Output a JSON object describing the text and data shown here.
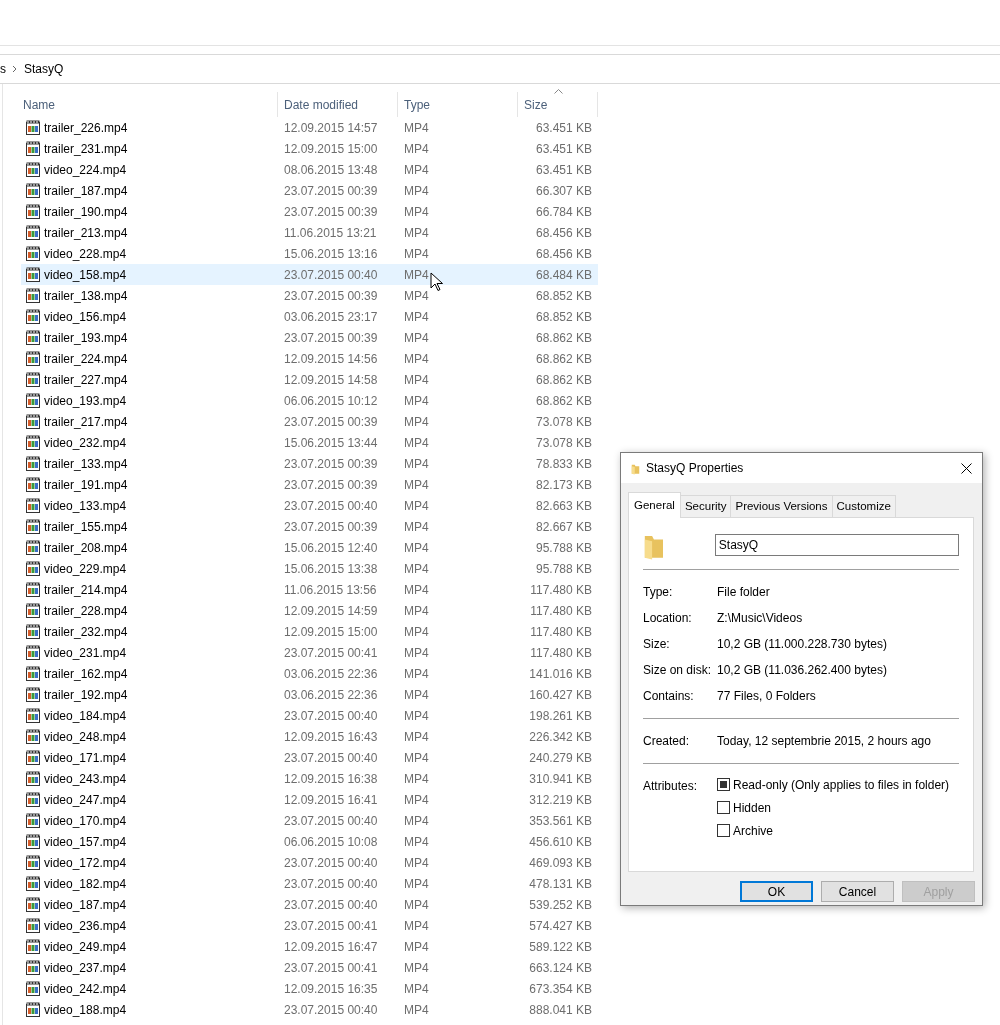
{
  "breadcrumb": {
    "cut_segment": "s",
    "current": "StasyQ"
  },
  "columns": [
    {
      "label": "Name",
      "sorted": false
    },
    {
      "label": "Date modified",
      "sorted": false
    },
    {
      "label": "Type",
      "sorted": false
    },
    {
      "label": "Size",
      "sorted": true
    }
  ],
  "files": [
    {
      "name": "trailer_226.mp4",
      "date": "12.09.2015 14:57",
      "type": "MP4",
      "size": "63.451 KB",
      "hovered": false
    },
    {
      "name": "trailer_231.mp4",
      "date": "12.09.2015 15:00",
      "type": "MP4",
      "size": "63.451 KB",
      "hovered": false
    },
    {
      "name": "video_224.mp4",
      "date": "08.06.2015 13:48",
      "type": "MP4",
      "size": "63.451 KB",
      "hovered": false
    },
    {
      "name": "trailer_187.mp4",
      "date": "23.07.2015 00:39",
      "type": "MP4",
      "size": "66.307 KB",
      "hovered": false
    },
    {
      "name": "trailer_190.mp4",
      "date": "23.07.2015 00:39",
      "type": "MP4",
      "size": "66.784 KB",
      "hovered": false
    },
    {
      "name": "trailer_213.mp4",
      "date": "11.06.2015 13:21",
      "type": "MP4",
      "size": "68.456 KB",
      "hovered": false
    },
    {
      "name": "video_228.mp4",
      "date": "15.06.2015 13:16",
      "type": "MP4",
      "size": "68.456 KB",
      "hovered": false
    },
    {
      "name": "video_158.mp4",
      "date": "23.07.2015 00:40",
      "type": "MP4",
      "size": "68.484 KB",
      "hovered": true
    },
    {
      "name": "trailer_138.mp4",
      "date": "23.07.2015 00:39",
      "type": "MP4",
      "size": "68.852 KB",
      "hovered": false
    },
    {
      "name": "video_156.mp4",
      "date": "03.06.2015 23:17",
      "type": "MP4",
      "size": "68.852 KB",
      "hovered": false
    },
    {
      "name": "trailer_193.mp4",
      "date": "23.07.2015 00:39",
      "type": "MP4",
      "size": "68.862 KB",
      "hovered": false
    },
    {
      "name": "trailer_224.mp4",
      "date": "12.09.2015 14:56",
      "type": "MP4",
      "size": "68.862 KB",
      "hovered": false
    },
    {
      "name": "trailer_227.mp4",
      "date": "12.09.2015 14:58",
      "type": "MP4",
      "size": "68.862 KB",
      "hovered": false
    },
    {
      "name": "video_193.mp4",
      "date": "06.06.2015 10:12",
      "type": "MP4",
      "size": "68.862 KB",
      "hovered": false
    },
    {
      "name": "trailer_217.mp4",
      "date": "23.07.2015 00:39",
      "type": "MP4",
      "size": "73.078 KB",
      "hovered": false
    },
    {
      "name": "video_232.mp4",
      "date": "15.06.2015 13:44",
      "type": "MP4",
      "size": "73.078 KB",
      "hovered": false
    },
    {
      "name": "trailer_133.mp4",
      "date": "23.07.2015 00:39",
      "type": "MP4",
      "size": "78.833 KB",
      "hovered": false
    },
    {
      "name": "trailer_191.mp4",
      "date": "23.07.2015 00:39",
      "type": "MP4",
      "size": "82.173 KB",
      "hovered": false
    },
    {
      "name": "video_133.mp4",
      "date": "23.07.2015 00:40",
      "type": "MP4",
      "size": "82.663 KB",
      "hovered": false
    },
    {
      "name": "trailer_155.mp4",
      "date": "23.07.2015 00:39",
      "type": "MP4",
      "size": "82.667 KB",
      "hovered": false
    },
    {
      "name": "trailer_208.mp4",
      "date": "15.06.2015 12:40",
      "type": "MP4",
      "size": "95.788 KB",
      "hovered": false
    },
    {
      "name": "video_229.mp4",
      "date": "15.06.2015 13:38",
      "type": "MP4",
      "size": "95.788 KB",
      "hovered": false
    },
    {
      "name": "trailer_214.mp4",
      "date": "11.06.2015 13:56",
      "type": "MP4",
      "size": "117.480 KB",
      "hovered": false
    },
    {
      "name": "trailer_228.mp4",
      "date": "12.09.2015 14:59",
      "type": "MP4",
      "size": "117.480 KB",
      "hovered": false
    },
    {
      "name": "trailer_232.mp4",
      "date": "12.09.2015 15:00",
      "type": "MP4",
      "size": "117.480 KB",
      "hovered": false
    },
    {
      "name": "video_231.mp4",
      "date": "23.07.2015 00:41",
      "type": "MP4",
      "size": "117.480 KB",
      "hovered": false
    },
    {
      "name": "trailer_162.mp4",
      "date": "03.06.2015 22:36",
      "type": "MP4",
      "size": "141.016 KB",
      "hovered": false
    },
    {
      "name": "trailer_192.mp4",
      "date": "03.06.2015 22:36",
      "type": "MP4",
      "size": "160.427 KB",
      "hovered": false
    },
    {
      "name": "video_184.mp4",
      "date": "23.07.2015 00:40",
      "type": "MP4",
      "size": "198.261 KB",
      "hovered": false
    },
    {
      "name": "video_248.mp4",
      "date": "12.09.2015 16:43",
      "type": "MP4",
      "size": "226.342 KB",
      "hovered": false
    },
    {
      "name": "video_171.mp4",
      "date": "23.07.2015 00:40",
      "type": "MP4",
      "size": "240.279 KB",
      "hovered": false
    },
    {
      "name": "video_243.mp4",
      "date": "12.09.2015 16:38",
      "type": "MP4",
      "size": "310.941 KB",
      "hovered": false
    },
    {
      "name": "video_247.mp4",
      "date": "12.09.2015 16:41",
      "type": "MP4",
      "size": "312.219 KB",
      "hovered": false
    },
    {
      "name": "video_170.mp4",
      "date": "23.07.2015 00:40",
      "type": "MP4",
      "size": "353.561 KB",
      "hovered": false
    },
    {
      "name": "video_157.mp4",
      "date": "06.06.2015 10:08",
      "type": "MP4",
      "size": "456.610 KB",
      "hovered": false
    },
    {
      "name": "video_172.mp4",
      "date": "23.07.2015 00:40",
      "type": "MP4",
      "size": "469.093 KB",
      "hovered": false
    },
    {
      "name": "video_182.mp4",
      "date": "23.07.2015 00:40",
      "type": "MP4",
      "size": "478.131 KB",
      "hovered": false
    },
    {
      "name": "video_187.mp4",
      "date": "23.07.2015 00:40",
      "type": "MP4",
      "size": "539.252 KB",
      "hovered": false
    },
    {
      "name": "video_236.mp4",
      "date": "23.07.2015 00:41",
      "type": "MP4",
      "size": "574.427 KB",
      "hovered": false
    },
    {
      "name": "video_249.mp4",
      "date": "12.09.2015 16:47",
      "type": "MP4",
      "size": "589.122 KB",
      "hovered": false
    },
    {
      "name": "video_237.mp4",
      "date": "23.07.2015 00:41",
      "type": "MP4",
      "size": "663.124 KB",
      "hovered": false
    },
    {
      "name": "video_242.mp4",
      "date": "12.09.2015 16:35",
      "type": "MP4",
      "size": "673.354 KB",
      "hovered": false
    },
    {
      "name": "video_188.mp4",
      "date": "23.07.2015 00:40",
      "type": "MP4",
      "size": "888.041 KB",
      "hovered": false
    }
  ],
  "dialog": {
    "title": "StasyQ Properties",
    "tabs": [
      {
        "label": "General",
        "selected": true
      },
      {
        "label": "Security",
        "selected": false
      },
      {
        "label": "Previous Versions",
        "selected": false
      },
      {
        "label": "Customize",
        "selected": false
      }
    ],
    "folder_name": "StasyQ",
    "groups": [
      [
        {
          "label": "Type:",
          "value": "File folder"
        },
        {
          "label": "Location:",
          "value": "Z:\\Music\\Videos"
        },
        {
          "label": "Size:",
          "value": "10,2 GB (11.000.228.730 bytes)"
        },
        {
          "label": "Size on disk:",
          "value": "10,2 GB (11.036.262.400 bytes)"
        },
        {
          "label": "Contains:",
          "value": "77 Files, 0 Folders"
        }
      ],
      [
        {
          "label": "Created:",
          "value": "Today, 12 septembrie 2015, 2 hours ago"
        }
      ]
    ],
    "attributes_label": "Attributes:",
    "attributes": [
      {
        "label": "Read-only (Only applies to files in folder)",
        "checked": false,
        "indeterminate": true
      },
      {
        "label": "Hidden",
        "checked": false,
        "indeterminate": false
      },
      {
        "label": "Archive",
        "checked": false,
        "indeterminate": false
      }
    ],
    "buttons": [
      {
        "label": "OK",
        "default": true,
        "disabled": false
      },
      {
        "label": "Cancel",
        "default": false,
        "disabled": false
      },
      {
        "label": "Apply",
        "default": false,
        "disabled": true
      }
    ]
  }
}
